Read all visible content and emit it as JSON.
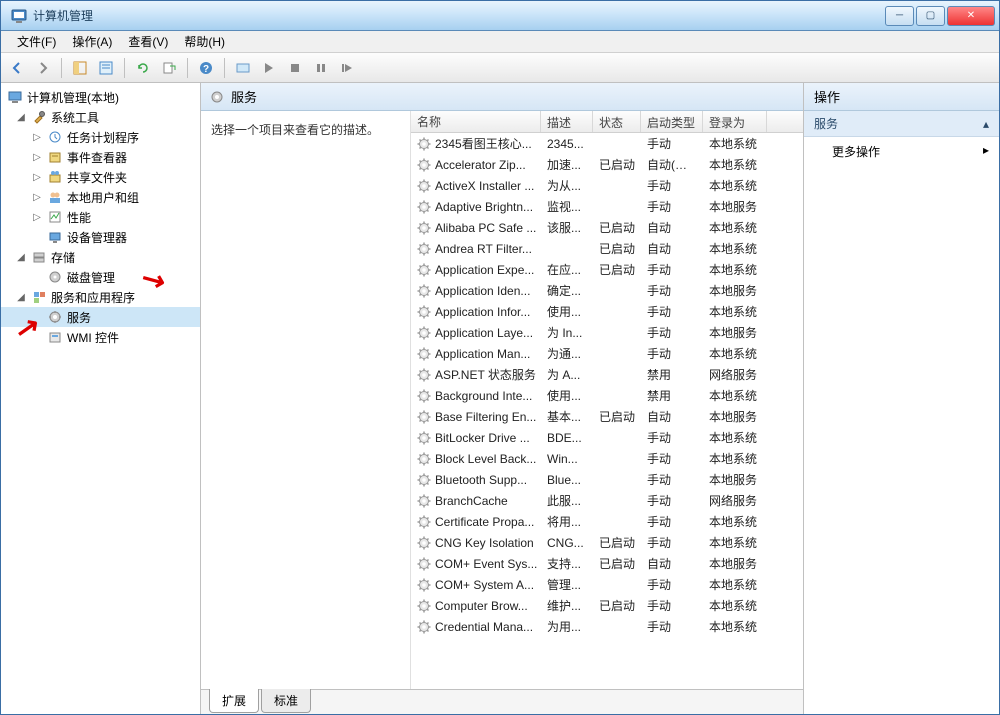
{
  "window": {
    "title": "计算机管理"
  },
  "menu": {
    "file": "文件(F)",
    "action": "操作(A)",
    "view": "查看(V)",
    "help": "帮助(H)"
  },
  "tree": {
    "root": "计算机管理(本地)",
    "sys_tools": "系统工具",
    "task_scheduler": "任务计划程序",
    "event_viewer": "事件查看器",
    "shared_folders": "共享文件夹",
    "local_users": "本地用户和组",
    "performance": "性能",
    "device_manager": "设备管理器",
    "storage": "存储",
    "disk_mgmt": "磁盘管理",
    "services_apps": "服务和应用程序",
    "services": "服务",
    "wmi": "WMI 控件"
  },
  "center": {
    "header": "服务",
    "desc_prompt": "选择一个项目来查看它的描述。",
    "columns": {
      "name": "名称",
      "desc": "描述",
      "status": "状态",
      "startup": "启动类型",
      "logon": "登录为"
    },
    "tabs": {
      "extended": "扩展",
      "standard": "标准"
    }
  },
  "services": [
    {
      "name": "2345看图王核心...",
      "desc": "2345...",
      "status": "",
      "startup": "手动",
      "logon": "本地系统"
    },
    {
      "name": "Accelerator  Zip...",
      "desc": "加速...",
      "status": "已启动",
      "startup": "自动(延迟...",
      "logon": "本地系统"
    },
    {
      "name": "ActiveX Installer ...",
      "desc": "为从...",
      "status": "",
      "startup": "手动",
      "logon": "本地系统"
    },
    {
      "name": "Adaptive Brightn...",
      "desc": "监视...",
      "status": "",
      "startup": "手动",
      "logon": "本地服务"
    },
    {
      "name": "Alibaba PC Safe ...",
      "desc": "该服...",
      "status": "已启动",
      "startup": "自动",
      "logon": "本地系统"
    },
    {
      "name": "Andrea RT Filter...",
      "desc": "",
      "status": "已启动",
      "startup": "自动",
      "logon": "本地系统"
    },
    {
      "name": "Application Expe...",
      "desc": "在应...",
      "status": "已启动",
      "startup": "手动",
      "logon": "本地系统"
    },
    {
      "name": "Application Iden...",
      "desc": "确定...",
      "status": "",
      "startup": "手动",
      "logon": "本地服务"
    },
    {
      "name": "Application Infor...",
      "desc": "使用...",
      "status": "",
      "startup": "手动",
      "logon": "本地系统"
    },
    {
      "name": "Application Laye...",
      "desc": "为 In...",
      "status": "",
      "startup": "手动",
      "logon": "本地服务"
    },
    {
      "name": "Application Man...",
      "desc": "为通...",
      "status": "",
      "startup": "手动",
      "logon": "本地系统"
    },
    {
      "name": "ASP.NET 状态服务",
      "desc": "为 A...",
      "status": "",
      "startup": "禁用",
      "logon": "网络服务"
    },
    {
      "name": "Background Inte...",
      "desc": "使用...",
      "status": "",
      "startup": "禁用",
      "logon": "本地系统"
    },
    {
      "name": "Base Filtering En...",
      "desc": "基本...",
      "status": "已启动",
      "startup": "自动",
      "logon": "本地服务"
    },
    {
      "name": "BitLocker Drive ...",
      "desc": "BDE...",
      "status": "",
      "startup": "手动",
      "logon": "本地系统"
    },
    {
      "name": "Block Level Back...",
      "desc": "Win...",
      "status": "",
      "startup": "手动",
      "logon": "本地系统"
    },
    {
      "name": "Bluetooth Supp...",
      "desc": "Blue...",
      "status": "",
      "startup": "手动",
      "logon": "本地服务"
    },
    {
      "name": "BranchCache",
      "desc": "此服...",
      "status": "",
      "startup": "手动",
      "logon": "网络服务"
    },
    {
      "name": "Certificate Propa...",
      "desc": "将用...",
      "status": "",
      "startup": "手动",
      "logon": "本地系统"
    },
    {
      "name": "CNG Key Isolation",
      "desc": "CNG...",
      "status": "已启动",
      "startup": "手动",
      "logon": "本地系统"
    },
    {
      "name": "COM+ Event Sys...",
      "desc": "支持...",
      "status": "已启动",
      "startup": "自动",
      "logon": "本地服务"
    },
    {
      "name": "COM+ System A...",
      "desc": "管理...",
      "status": "",
      "startup": "手动",
      "logon": "本地系统"
    },
    {
      "name": "Computer Brow...",
      "desc": "维护...",
      "status": "已启动",
      "startup": "手动",
      "logon": "本地系统"
    },
    {
      "name": "Credential Mana...",
      "desc": "为用...",
      "status": "",
      "startup": "手动",
      "logon": "本地系统"
    }
  ],
  "actions": {
    "header": "操作",
    "sub": "服务",
    "more": "更多操作"
  }
}
